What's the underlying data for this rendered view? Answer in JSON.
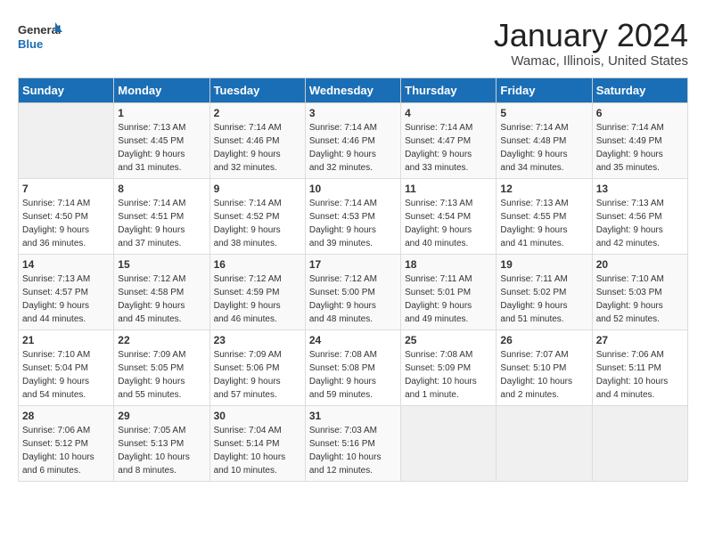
{
  "header": {
    "logo_line1": "General",
    "logo_line2": "Blue",
    "month": "January 2024",
    "location": "Wamac, Illinois, United States"
  },
  "days_of_week": [
    "Sunday",
    "Monday",
    "Tuesday",
    "Wednesday",
    "Thursday",
    "Friday",
    "Saturday"
  ],
  "weeks": [
    [
      {
        "day": "",
        "info": ""
      },
      {
        "day": "1",
        "info": "Sunrise: 7:13 AM\nSunset: 4:45 PM\nDaylight: 9 hours\nand 31 minutes."
      },
      {
        "day": "2",
        "info": "Sunrise: 7:14 AM\nSunset: 4:46 PM\nDaylight: 9 hours\nand 32 minutes."
      },
      {
        "day": "3",
        "info": "Sunrise: 7:14 AM\nSunset: 4:46 PM\nDaylight: 9 hours\nand 32 minutes."
      },
      {
        "day": "4",
        "info": "Sunrise: 7:14 AM\nSunset: 4:47 PM\nDaylight: 9 hours\nand 33 minutes."
      },
      {
        "day": "5",
        "info": "Sunrise: 7:14 AM\nSunset: 4:48 PM\nDaylight: 9 hours\nand 34 minutes."
      },
      {
        "day": "6",
        "info": "Sunrise: 7:14 AM\nSunset: 4:49 PM\nDaylight: 9 hours\nand 35 minutes."
      }
    ],
    [
      {
        "day": "7",
        "info": "Sunrise: 7:14 AM\nSunset: 4:50 PM\nDaylight: 9 hours\nand 36 minutes."
      },
      {
        "day": "8",
        "info": "Sunrise: 7:14 AM\nSunset: 4:51 PM\nDaylight: 9 hours\nand 37 minutes."
      },
      {
        "day": "9",
        "info": "Sunrise: 7:14 AM\nSunset: 4:52 PM\nDaylight: 9 hours\nand 38 minutes."
      },
      {
        "day": "10",
        "info": "Sunrise: 7:14 AM\nSunset: 4:53 PM\nDaylight: 9 hours\nand 39 minutes."
      },
      {
        "day": "11",
        "info": "Sunrise: 7:13 AM\nSunset: 4:54 PM\nDaylight: 9 hours\nand 40 minutes."
      },
      {
        "day": "12",
        "info": "Sunrise: 7:13 AM\nSunset: 4:55 PM\nDaylight: 9 hours\nand 41 minutes."
      },
      {
        "day": "13",
        "info": "Sunrise: 7:13 AM\nSunset: 4:56 PM\nDaylight: 9 hours\nand 42 minutes."
      }
    ],
    [
      {
        "day": "14",
        "info": "Sunrise: 7:13 AM\nSunset: 4:57 PM\nDaylight: 9 hours\nand 44 minutes."
      },
      {
        "day": "15",
        "info": "Sunrise: 7:12 AM\nSunset: 4:58 PM\nDaylight: 9 hours\nand 45 minutes."
      },
      {
        "day": "16",
        "info": "Sunrise: 7:12 AM\nSunset: 4:59 PM\nDaylight: 9 hours\nand 46 minutes."
      },
      {
        "day": "17",
        "info": "Sunrise: 7:12 AM\nSunset: 5:00 PM\nDaylight: 9 hours\nand 48 minutes."
      },
      {
        "day": "18",
        "info": "Sunrise: 7:11 AM\nSunset: 5:01 PM\nDaylight: 9 hours\nand 49 minutes."
      },
      {
        "day": "19",
        "info": "Sunrise: 7:11 AM\nSunset: 5:02 PM\nDaylight: 9 hours\nand 51 minutes."
      },
      {
        "day": "20",
        "info": "Sunrise: 7:10 AM\nSunset: 5:03 PM\nDaylight: 9 hours\nand 52 minutes."
      }
    ],
    [
      {
        "day": "21",
        "info": "Sunrise: 7:10 AM\nSunset: 5:04 PM\nDaylight: 9 hours\nand 54 minutes."
      },
      {
        "day": "22",
        "info": "Sunrise: 7:09 AM\nSunset: 5:05 PM\nDaylight: 9 hours\nand 55 minutes."
      },
      {
        "day": "23",
        "info": "Sunrise: 7:09 AM\nSunset: 5:06 PM\nDaylight: 9 hours\nand 57 minutes."
      },
      {
        "day": "24",
        "info": "Sunrise: 7:08 AM\nSunset: 5:08 PM\nDaylight: 9 hours\nand 59 minutes."
      },
      {
        "day": "25",
        "info": "Sunrise: 7:08 AM\nSunset: 5:09 PM\nDaylight: 10 hours\nand 1 minute."
      },
      {
        "day": "26",
        "info": "Sunrise: 7:07 AM\nSunset: 5:10 PM\nDaylight: 10 hours\nand 2 minutes."
      },
      {
        "day": "27",
        "info": "Sunrise: 7:06 AM\nSunset: 5:11 PM\nDaylight: 10 hours\nand 4 minutes."
      }
    ],
    [
      {
        "day": "28",
        "info": "Sunrise: 7:06 AM\nSunset: 5:12 PM\nDaylight: 10 hours\nand 6 minutes."
      },
      {
        "day": "29",
        "info": "Sunrise: 7:05 AM\nSunset: 5:13 PM\nDaylight: 10 hours\nand 8 minutes."
      },
      {
        "day": "30",
        "info": "Sunrise: 7:04 AM\nSunset: 5:14 PM\nDaylight: 10 hours\nand 10 minutes."
      },
      {
        "day": "31",
        "info": "Sunrise: 7:03 AM\nSunset: 5:16 PM\nDaylight: 10 hours\nand 12 minutes."
      },
      {
        "day": "",
        "info": ""
      },
      {
        "day": "",
        "info": ""
      },
      {
        "day": "",
        "info": ""
      }
    ]
  ]
}
